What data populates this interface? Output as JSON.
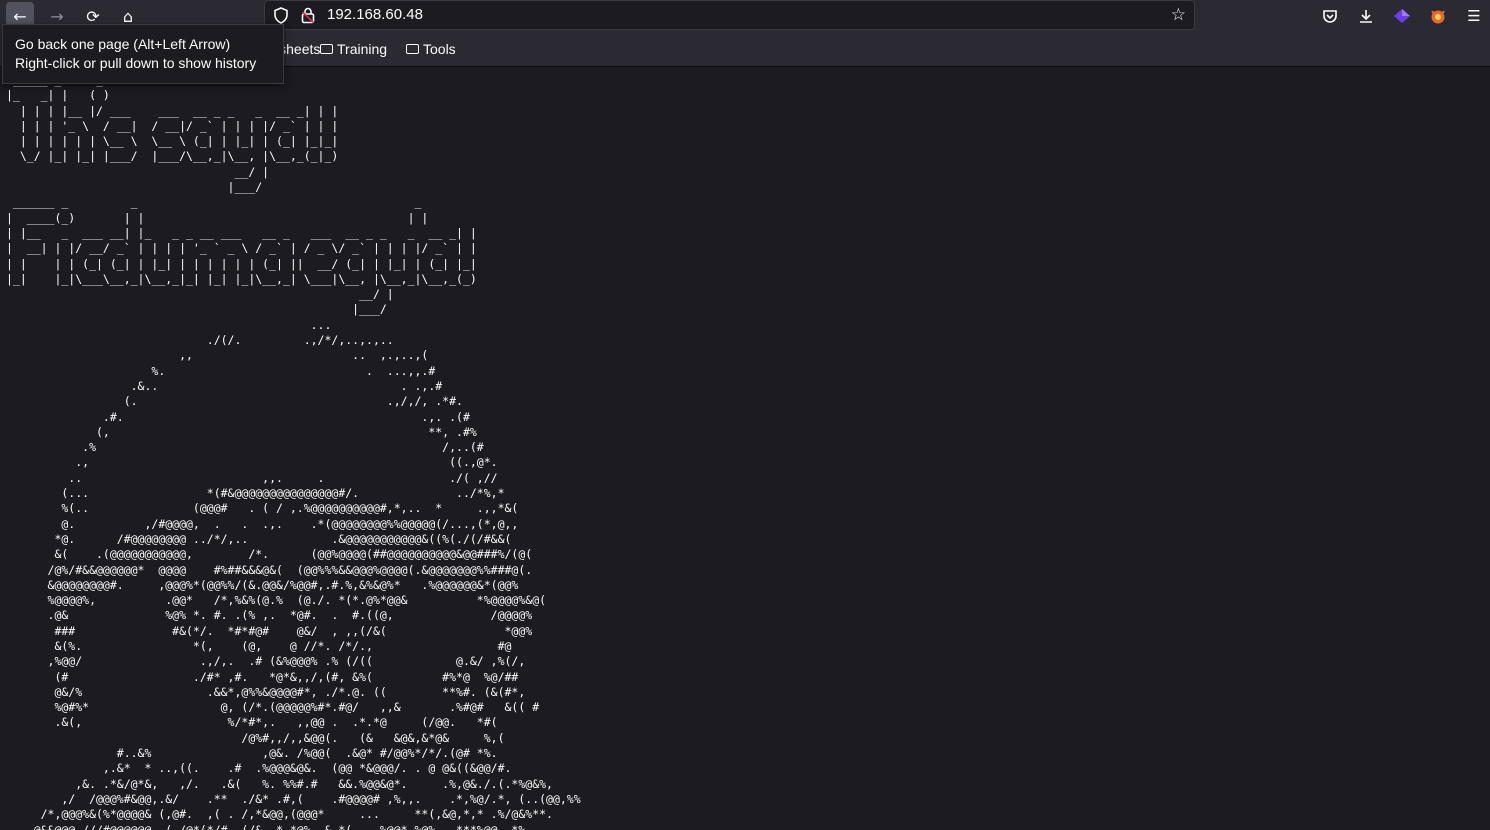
{
  "browser": {
    "url": "192.168.60.48",
    "icons": {
      "back": "arrow-left-icon",
      "forward": "arrow-right-icon",
      "reload": "reload-icon",
      "home": "home-icon",
      "shield": "shield-icon",
      "lock": "lock-icon",
      "star": "star-icon",
      "pocket": "pocket-icon",
      "download": "download-icon",
      "menu": "hamburger-icon"
    }
  },
  "bookmarks": {
    "partial_label": "heat sheets",
    "items": [
      {
        "label": "Training"
      },
      {
        "label": "Tools"
      }
    ]
  },
  "tooltip": {
    "line1": "Go back one page (Alt+Left Arrow)",
    "line2": "Right-click or pull down to show history"
  },
  "page": {
    "ascii_art": " _____ _     _\n|_   _| |   ( )\n  | | | |__ |/ ___    ___  __ _ _   _  __ _| | |\n  | | | '_ \\  / __|  / __|/ _` | | | |/ _` | | |\n  | | | | | | \\__ \\  \\__ \\ (_| | |_| | (_| |_|_|\n  \\_/ |_| |_| |___/  |___/\\__,_|\\__, |\\__,_(_|_)\n                                 __/ |\n                                |___/\n ______ _         _                                        _\n|  ____(_)       | |                                      | |\n| |__   _  ___ __| |_   _ _ __ ___   __ _   ___  __ _ _   _  __ _| |\n|  __| | |/ __/ _` | | | | '_ ` _ \\ / _` | / _ \\/ _` | | | |/ _` | |\n| |    | | (_| (_| | |_| | | | | | | (_| ||  __/ (_| | |_| | (_| |_|\n|_|    |_|\\___\\__,_|\\__,_|_| |_| |_|\\__,_| \\___|\\__, |\\__,_|\\__,_(_)\n                                                   __/ |\n                                                  |___/\n                                            ...\n                             ./(/.         .,/*/,..,.,..\n                         ,,                       ..  ,.,..,(\n                     %.                             .  ...,,.#\n                  .&..                                   . .,.#\n                 (.                                    .,/,/, .*#.\n              .#.                                           .,. .(#\n             (,                                              **, .#%\n           .%                                                  /,..(#\n          .,                                                    ((.,@*.\n         ..                          ,,.     .                  ./( ,//\n        (...                 *(#&@@@@@@@@@@@@@@@#/.              ../*%,*\n        %(..               (@@@#   . ( / ,.%@@@@@@@@@@#,*,..  *     .,,*&(\n        @.          ,/#@@@@,  .   .  .,.    .*(@@@@@@@@%%@@@@@(/...,(*,@,,\n       *@.      /#@@@@@@@@ ../*/,..            .&@@@@@@@@@@@&((%(./(/#&&(\n       &(    .(@@@@@@@@@@@,        /*.      (@@%@@@@(##@@@@@@@@@@&@@###%/(@(\n      /@%/#&&@@@@@@*  @@@@    #%##&&&@&(  (@@%%%&&@@@%@@@@(.&@@@@@@@%%###@(.\n      &@@@@@@@@#.     ,@@@%*(@@%%/(&.@@&/%@@#,.#.%,&%&@%*   .%@@@@@@&*(@@%\n      %@@@@%,          .@@*   /*,%&%(@.%  (@./. *(*.@%*@@&          *%@@@@%&@(\n      .@&              %@% *. #. .(% ,.  *@#.  .  #.((@,              /@@@@%\n       ###              #&(*/.  *#*#@#    @&/  , ,,(/&(                 *@@%\n       &(%.                *(,    (@,    @ //*. /*/.,                  #@\n      ,%@@/                 .,/,.  .# (&%@@@% .% (/((            @.&/ ,%(/,\n       (#                  ./#* ,#.   *@*&,,/,(#, &%(          #%*@  %@/##\n       @&/%                  .&&*,@%%&@@@@#*, ./*.@. ((        **%#. (&(#*,\n       %@#%*                   @, (/*.(@@@@@%#*.#@/   ,,&       .%#@#   &(( #\n       .&(,                     %/*#*,.   ,,@@ .  .*.*@     (/@@.   *#(\n                                  /@%#,,/,,&@@(.   (&   &@&,&*@&     %,(\n                #..&%                ,@&. /%@@(  .&@* #/@@%*/*/.(@# *%.\n              ,.&*  * ..,((.    .#  .%@@@&@&.  (@@ *&@@@/. . @ @&((&@@/#.\n          ,&. .*&/@*&,   ,/.   .&(   %. %%#.#   &&.%@@&@*.     .%,@&./.(.*%@&%,\n        ,/  /@@@%#&@@,.&/    .**  ./&* .#,(    .#@@@@# ,%,,.    .*,%@/.*, (..(@@,%%\n     /*,@@@%&(%*@@@@& (,@#.  ,( . /,*&@@,(@@@*     ...     **(,&@,*,* .%/@&%**.\n    @&&@@@.///#@@@@@@. ( /@*(*/# .(/&..* *@%. &.*(.. .%@@*.%@%...***%@@ .*%."
  }
}
